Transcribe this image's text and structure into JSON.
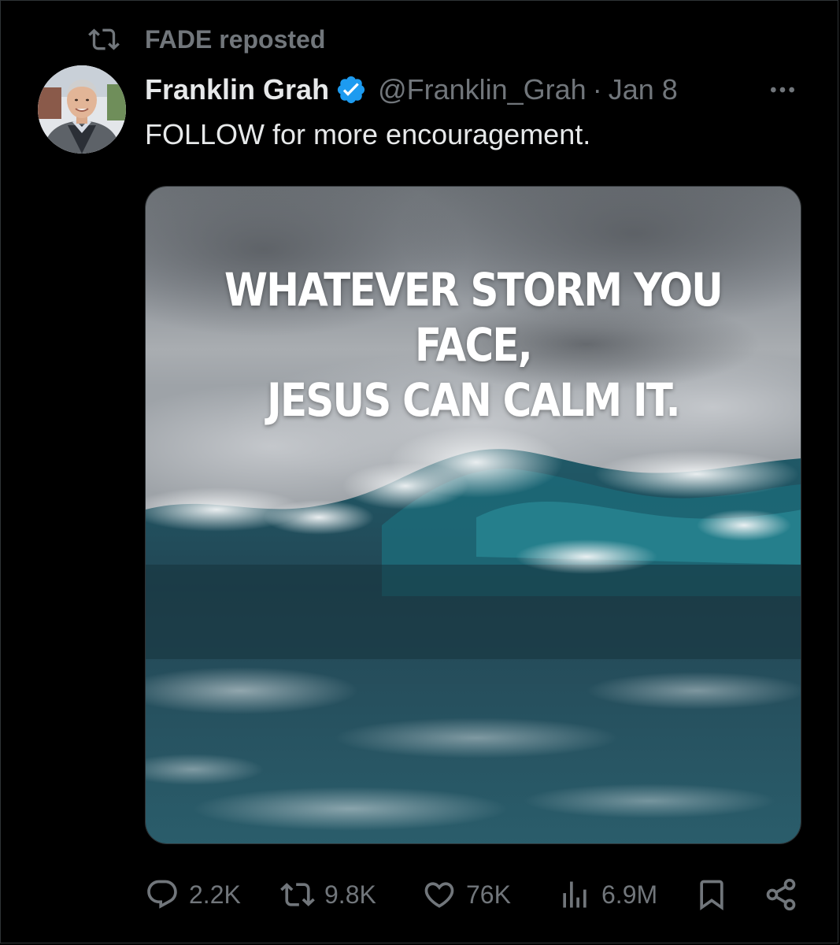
{
  "repost": {
    "icon": "repost-icon",
    "text": "FADE reposted"
  },
  "tweet": {
    "avatar_icon": "user-avatar",
    "display_name": "Franklin Grah",
    "verified_icon": "verified-badge-icon",
    "handle": "@Franklin_Grah",
    "separator": "·",
    "date": "Jan 8",
    "more_icon": "more-options-icon",
    "text": "FOLLOW for more encouragement.",
    "media": {
      "caption_line1": "WHATEVER STORM YOU FACE,",
      "caption_line2": "JESUS CAN CALM IT."
    }
  },
  "actions": {
    "reply": {
      "icon": "reply-icon",
      "count": "2.2K"
    },
    "repost": {
      "icon": "repost-icon",
      "count": "9.8K"
    },
    "like": {
      "icon": "heart-icon",
      "count": "76K"
    },
    "views": {
      "icon": "views-chart-icon",
      "count": "6.9M"
    },
    "bookmark": {
      "icon": "bookmark-icon"
    },
    "share": {
      "icon": "share-icon"
    }
  },
  "colors": {
    "background": "#000000",
    "primary_text": "#e7e9ea",
    "secondary_text": "#71767b",
    "verified_blue": "#1d9bf0"
  }
}
